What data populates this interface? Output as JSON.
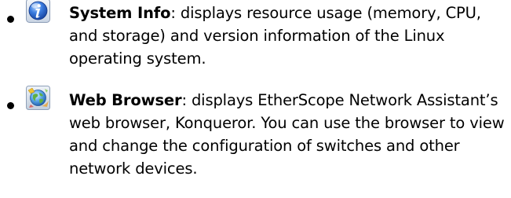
{
  "items": [
    {
      "icon": "info-icon",
      "title": "System Info",
      "description": ": displays resource usage (memory, CPU, and storage) and version information of the Linux operating system."
    },
    {
      "icon": "globe-icon",
      "title": "Web Browser",
      "description": ": displays EtherScope Network Assistant’s web browser, Konqueror. You can use the browser to view and change the configuration of switches and other network devices."
    }
  ]
}
